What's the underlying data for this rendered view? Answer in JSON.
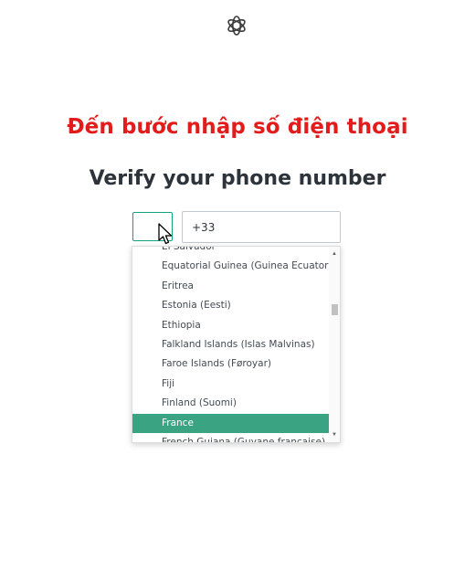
{
  "annotation": {
    "text": "Đến bước nhập số điện thoại"
  },
  "page": {
    "title": "Verify your phone number"
  },
  "phone_input": {
    "value": "+33"
  },
  "country_dropdown": {
    "options": [
      "El Salvador",
      "Equatorial Guinea (Guinea Ecuatorial)",
      "Eritrea",
      "Estonia (Eesti)",
      "Ethiopia",
      "Falkland Islands (Islas Malvinas)",
      "Faroe Islands (Føroyar)",
      "Fiji",
      "Finland (Suomi)",
      "France",
      "French Guiana (Guyane française)"
    ],
    "selected": "France"
  },
  "icons": {
    "logo": "openai-logo-icon",
    "cursor": "mouse-pointer-icon",
    "scroll_up": "triangle-up-icon",
    "scroll_down": "triangle-down-icon"
  },
  "colors": {
    "annotation": "#e21b1b",
    "title": "#2d333a",
    "accent": "#10a37f",
    "selected_option": "#3aa482"
  }
}
